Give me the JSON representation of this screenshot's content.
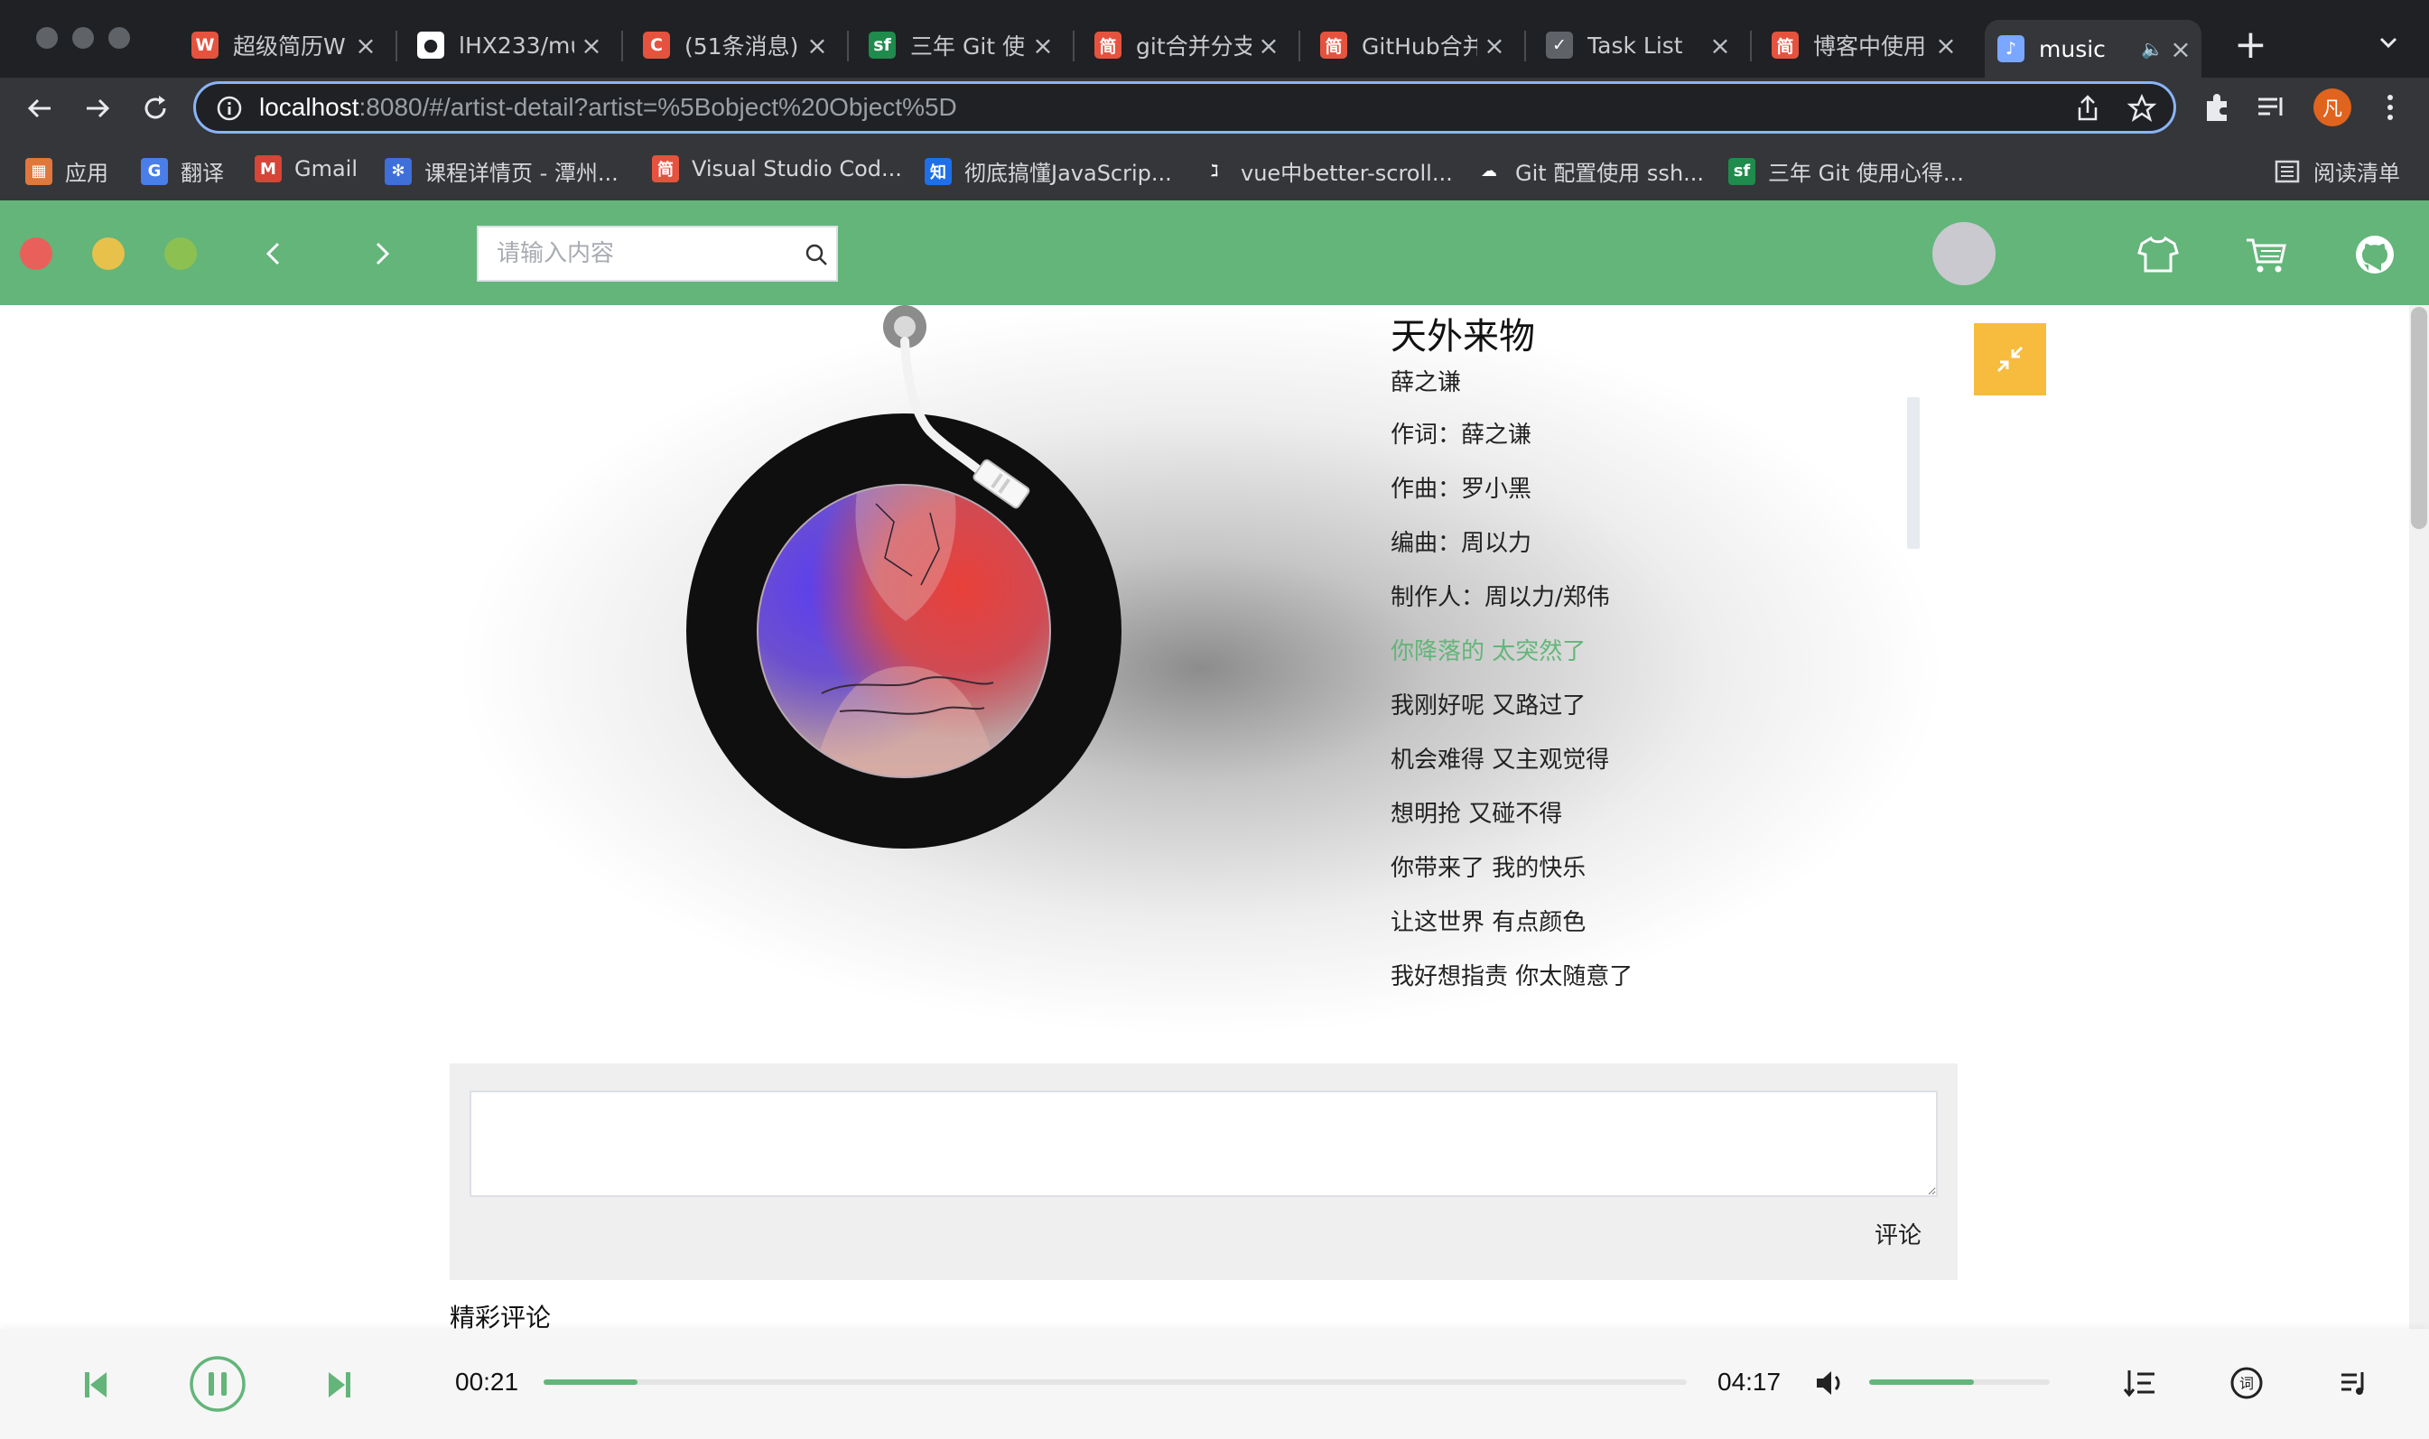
{
  "browser": {
    "tabs": [
      {
        "title": "超级简历W",
        "favicon": "resume-icon",
        "color": "#e5533e",
        "glyph": "W"
      },
      {
        "title": "lHX233/mu",
        "favicon": "github-icon",
        "color": "#ffffff",
        "glyph": ""
      },
      {
        "title": "(51条消息)",
        "favicon": "csdn-icon",
        "color": "#e5533e",
        "glyph": "C"
      },
      {
        "title": "三年 Git 使",
        "favicon": "segmentfault-icon",
        "color": "#1f8b4c",
        "glyph": "sf"
      },
      {
        "title": "git合并分支",
        "favicon": "jianshu-icon",
        "color": "#e5533e",
        "glyph": "简"
      },
      {
        "title": "GitHub合并",
        "favicon": "jianshu-icon",
        "color": "#e5533e",
        "glyph": "简"
      },
      {
        "title": "Task List",
        "favicon": "checkmark-icon",
        "color": "#5f6368",
        "glyph": "✓"
      },
      {
        "title": "博客中使用",
        "favicon": "jianshu-icon",
        "color": "#e5533e",
        "glyph": "简"
      },
      {
        "title": "music",
        "favicon": "music-note-icon",
        "color": "#7aa7ff",
        "glyph": "♪",
        "active": true
      }
    ],
    "url_host": "localhost",
    "url_rest": ":8080/#/artist-detail?artist=%5Bobject%20Object%5D",
    "bookmarks": [
      {
        "label": "应用",
        "icon": "apps-grid-icon",
        "color": "#e0773b",
        "glyph": "▦"
      },
      {
        "label": "翻译",
        "icon": "google-translate-icon",
        "color": "#4a7ee8",
        "glyph": "G"
      },
      {
        "label": "Gmail",
        "icon": "gmail-icon",
        "color": "#d64537",
        "glyph": "M"
      },
      {
        "label": "课程详情页 - 潭州...",
        "icon": "gear-icon",
        "color": "#3f6fd8",
        "glyph": "✻"
      },
      {
        "label": "Visual Studio Cod...",
        "icon": "jianshu-icon",
        "color": "#e5533e",
        "glyph": "简"
      },
      {
        "label": "彻底搞懂JavaScrip...",
        "icon": "zhihu-icon",
        "color": "#1e6fe8",
        "glyph": "知"
      },
      {
        "label": "vue中better-scroll...",
        "icon": "runner-icon",
        "color": "#35363a",
        "glyph": "ℷ"
      },
      {
        "label": "Git 配置使用 ssh...",
        "icon": "cloud-icon",
        "color": "#35363a",
        "glyph": "☁"
      },
      {
        "label": "三年 Git 使用心得...",
        "icon": "segmentfault-icon",
        "color": "#1f8b4c",
        "glyph": "sf"
      }
    ],
    "reading_list": "阅读清单",
    "profile_initial": "凡"
  },
  "header": {
    "search_placeholder": "请输入内容",
    "accent": "#63b57a"
  },
  "song": {
    "title": "天外来物",
    "artist": "薛之谦",
    "lyrics": [
      "作词：薛之谦",
      "作曲：罗小黑",
      "编曲：周以力",
      "制作人：周以力/郑伟",
      "你降落的 太突然了",
      "我刚好呢 又路过了",
      "机会难得 又主观觉得",
      "想明抢 又碰不得",
      "你带来了 我的快乐",
      "让这世界 有点颜色",
      "我好想指责 你太随意了"
    ],
    "active_lyric_index": 4
  },
  "comments": {
    "submit_label": "评论",
    "section_title": "精彩评论",
    "textarea_value": ""
  },
  "player": {
    "current_time": "00:21",
    "total_time": "04:17",
    "progress_fraction": 0.082,
    "volume_fraction": 0.58
  }
}
